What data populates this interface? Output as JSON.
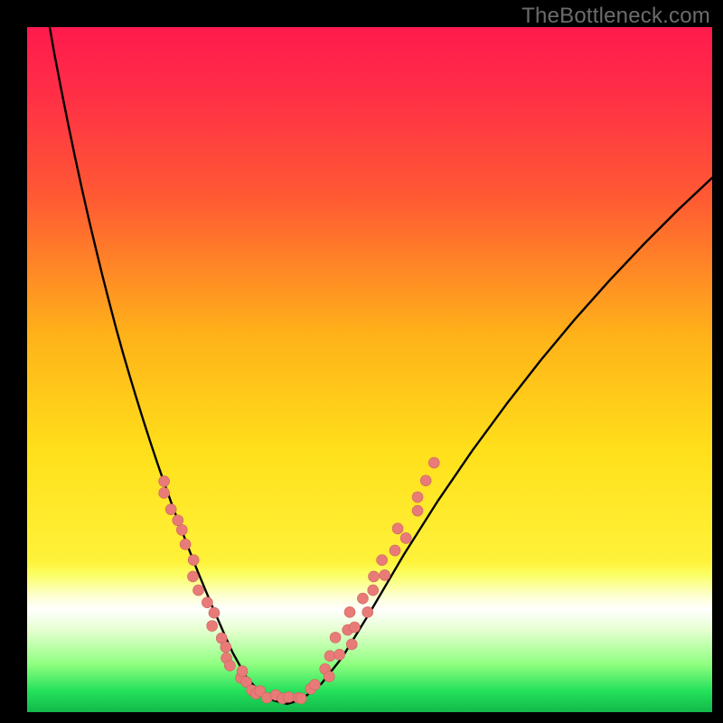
{
  "watermark": "TheBottleneck.com",
  "colors": {
    "frame": "#000000",
    "gradient_stops": [
      {
        "pos": 0.0,
        "color": "#ff1a4d"
      },
      {
        "pos": 0.1,
        "color": "#ff2f46"
      },
      {
        "pos": 0.25,
        "color": "#ff5a33"
      },
      {
        "pos": 0.45,
        "color": "#ffb219"
      },
      {
        "pos": 0.62,
        "color": "#ffe01a"
      },
      {
        "pos": 0.78,
        "color": "#fff23a"
      },
      {
        "pos": 0.8,
        "color": "#fbff66"
      },
      {
        "pos": 0.83,
        "color": "#fdffcf"
      },
      {
        "pos": 0.85,
        "color": "#ffffff"
      },
      {
        "pos": 0.88,
        "color": "#e6ffd0"
      },
      {
        "pos": 0.93,
        "color": "#8fff80"
      },
      {
        "pos": 0.97,
        "color": "#22e05a"
      },
      {
        "pos": 1.0,
        "color": "#13b84a"
      }
    ],
    "curve": "#000000",
    "dot_fill": "#e87b77",
    "dot_stroke": "#c96560"
  },
  "chart_data": {
    "type": "line",
    "title": "",
    "xlabel": "",
    "ylabel": "",
    "xlim": [
      0,
      100
    ],
    "ylim": [
      0,
      100
    ],
    "y_down": true,
    "series": [
      {
        "name": "bottleneck-curve",
        "x": [
          3.3,
          4.0,
          5.0,
          6.0,
          7.0,
          8.0,
          9.0,
          10.0,
          11.0,
          12.0,
          13.0,
          14.0,
          15.0,
          16.0,
          17.0,
          18.0,
          19.0,
          20.0,
          21.0,
          22.0,
          23.0,
          24.0,
          25.0,
          26.0,
          27.0,
          28.0,
          29.0,
          30.0,
          32.0,
          34.0,
          36.0,
          38.0,
          40.0,
          43.0,
          46.0,
          50.0,
          55.0,
          60.0,
          65.0,
          70.0,
          75.0,
          80.0,
          85.0,
          90.0,
          95.0,
          100.0
        ],
        "y": [
          0.0,
          4.0,
          9.2,
          14.2,
          19.0,
          23.6,
          28.0,
          32.2,
          36.3,
          40.2,
          44.0,
          47.6,
          51.0,
          54.3,
          57.5,
          60.6,
          63.6,
          66.5,
          69.3,
          72.0,
          74.6,
          77.2,
          79.7,
          82.1,
          84.5,
          86.8,
          89.1,
          91.3,
          94.9,
          97.1,
          98.3,
          98.8,
          98.2,
          95.8,
          92.0,
          85.5,
          77.0,
          69.1,
          61.8,
          55.0,
          48.6,
          42.6,
          37.0,
          31.7,
          26.7,
          22.0
        ]
      }
    ],
    "dots": [
      {
        "x": 20.0,
        "y": 66.3,
        "r": 6
      },
      {
        "x": 20.0,
        "y": 68.0,
        "r": 6
      },
      {
        "x": 21.0,
        "y": 70.4,
        "r": 6
      },
      {
        "x": 22.0,
        "y": 72.0,
        "r": 6
      },
      {
        "x": 22.6,
        "y": 73.4,
        "r": 6
      },
      {
        "x": 23.1,
        "y": 75.5,
        "r": 6
      },
      {
        "x": 24.3,
        "y": 77.8,
        "r": 6
      },
      {
        "x": 24.2,
        "y": 80.2,
        "r": 6
      },
      {
        "x": 25.0,
        "y": 82.2,
        "r": 6
      },
      {
        "x": 26.3,
        "y": 84.0,
        "r": 6
      },
      {
        "x": 27.3,
        "y": 85.5,
        "r": 6
      },
      {
        "x": 27.0,
        "y": 87.4,
        "r": 6
      },
      {
        "x": 28.4,
        "y": 89.2,
        "r": 6
      },
      {
        "x": 29.0,
        "y": 90.5,
        "r": 6
      },
      {
        "x": 29.1,
        "y": 92.1,
        "r": 6
      },
      {
        "x": 29.6,
        "y": 93.2,
        "r": 6
      },
      {
        "x": 31.2,
        "y": 95.0,
        "r": 6
      },
      {
        "x": 31.4,
        "y": 94.0,
        "r": 6
      },
      {
        "x": 32.0,
        "y": 95.6,
        "r": 6
      },
      {
        "x": 32.8,
        "y": 96.8,
        "r": 6
      },
      {
        "x": 33.4,
        "y": 97.3,
        "r": 6
      },
      {
        "x": 34.0,
        "y": 96.9,
        "r": 6
      },
      {
        "x": 35.0,
        "y": 97.9,
        "r": 6
      },
      {
        "x": 36.3,
        "y": 97.5,
        "r": 6
      },
      {
        "x": 37.3,
        "y": 98.0,
        "r": 6
      },
      {
        "x": 38.2,
        "y": 97.8,
        "r": 6
      },
      {
        "x": 39.6,
        "y": 97.9,
        "r": 6
      },
      {
        "x": 40.0,
        "y": 98.0,
        "r": 6
      },
      {
        "x": 41.4,
        "y": 96.6,
        "r": 6
      },
      {
        "x": 42.0,
        "y": 96.0,
        "r": 6
      },
      {
        "x": 43.5,
        "y": 93.7,
        "r": 6
      },
      {
        "x": 44.1,
        "y": 94.8,
        "r": 6
      },
      {
        "x": 44.2,
        "y": 91.8,
        "r": 6
      },
      {
        "x": 45.0,
        "y": 89.1,
        "r": 6
      },
      {
        "x": 45.6,
        "y": 91.6,
        "r": 6
      },
      {
        "x": 46.8,
        "y": 88.0,
        "r": 6
      },
      {
        "x": 47.4,
        "y": 90.1,
        "r": 6
      },
      {
        "x": 47.8,
        "y": 87.6,
        "r": 6
      },
      {
        "x": 47.1,
        "y": 85.4,
        "r": 6
      },
      {
        "x": 49.0,
        "y": 83.4,
        "r": 6
      },
      {
        "x": 49.7,
        "y": 85.4,
        "r": 6
      },
      {
        "x": 50.5,
        "y": 82.2,
        "r": 6
      },
      {
        "x": 50.6,
        "y": 80.2,
        "r": 6
      },
      {
        "x": 51.8,
        "y": 77.8,
        "r": 6
      },
      {
        "x": 52.2,
        "y": 80.0,
        "r": 6
      },
      {
        "x": 53.7,
        "y": 76.4,
        "r": 6
      },
      {
        "x": 54.1,
        "y": 73.2,
        "r": 6
      },
      {
        "x": 55.3,
        "y": 74.6,
        "r": 6
      },
      {
        "x": 57.0,
        "y": 68.6,
        "r": 6
      },
      {
        "x": 57.0,
        "y": 70.6,
        "r": 6
      },
      {
        "x": 58.2,
        "y": 66.2,
        "r": 6
      },
      {
        "x": 59.4,
        "y": 63.6,
        "r": 6
      }
    ]
  }
}
